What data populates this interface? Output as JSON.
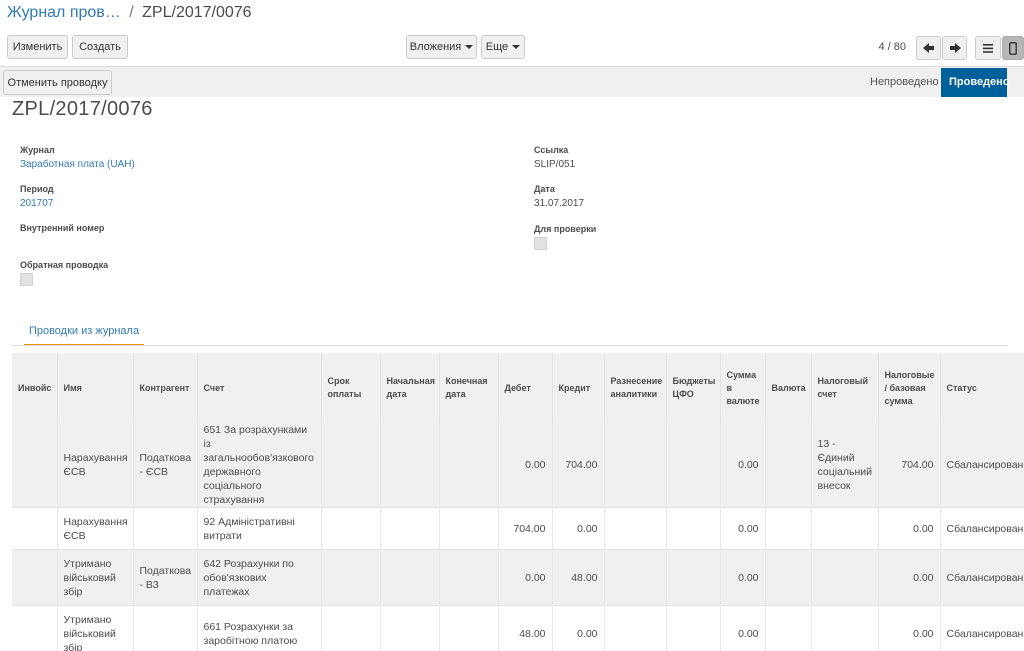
{
  "breadcrumb": {
    "parent": "Журнал пров…",
    "separator": "/",
    "current": "ZPL/2017/0076"
  },
  "toolbar": {
    "edit_label": "Изменить",
    "create_label": "Создать",
    "attachments_label": "Вложения",
    "more_label": "Еще",
    "pager": "4 / 80"
  },
  "statusbar": {
    "cancel_label": "Отменить проводку",
    "states": [
      "Непроведено",
      "Проведено"
    ],
    "active_state": "Проведено"
  },
  "form": {
    "title": "ZPL/2017/0076",
    "journal_label": "Журнал",
    "journal_value": "Заработная плата (UAH)",
    "period_label": "Период",
    "period_value": "201707",
    "internal_label": "Внутренний номер",
    "reverse_label": "Обратная проводка",
    "ref_label": "Ссылка",
    "ref_value": "SLIP/051",
    "date_label": "Дата",
    "date_value": "31.07.2017",
    "review_label": "Для проверки"
  },
  "tabs": [
    "Проводки из журнала"
  ],
  "table": {
    "headers": [
      "Инвойс",
      "Имя",
      "Контрагент",
      "Счет",
      "Срок оплаты",
      "Начальная дата",
      "Конечная дата",
      "Дебет",
      "Кредит",
      "Разнесение аналитики",
      "Бюджеты ЦФО",
      "Сумма в валюте",
      "Валюта",
      "Налоговый счет",
      "Налоговые / базовая сумма",
      "Статус"
    ],
    "rows": [
      [
        "",
        "Нарахування ЄСВ",
        "Податкова - ЄСВ",
        "651 За розрахунками із загальнообов'язкового державного соціального страхування",
        "",
        "",
        "",
        "0.00",
        "704.00",
        "",
        "",
        "0.00",
        "",
        "13 - Єдиний соціальний внесок",
        "704.00",
        "Сбалансирован"
      ],
      [
        "",
        "Нарахування ЄСВ",
        "",
        "92 Адміністративні витрати",
        "",
        "",
        "",
        "704.00",
        "0.00",
        "",
        "",
        "0.00",
        "",
        "",
        "0.00",
        "Сбалансирован"
      ],
      [
        "",
        "Утримано військовий збір",
        "Податкова - ВЗ",
        "642 Розрахунки по обов'язкових платежах",
        "",
        "",
        "",
        "0.00",
        "48.00",
        "",
        "",
        "0.00",
        "",
        "",
        "0.00",
        "Сбалансирован"
      ],
      [
        "",
        "Утримано військовий збір",
        "",
        "661 Розрахунки за заробітною платою",
        "",
        "",
        "",
        "48.00",
        "0.00",
        "",
        "",
        "0.00",
        "",
        "",
        "0.00",
        "Сбалансирован"
      ]
    ]
  },
  "icons": [
    "arrow-left-icon",
    "arrow-right-icon",
    "list-view-icon",
    "form-view-icon",
    "caret-down-icon"
  ]
}
